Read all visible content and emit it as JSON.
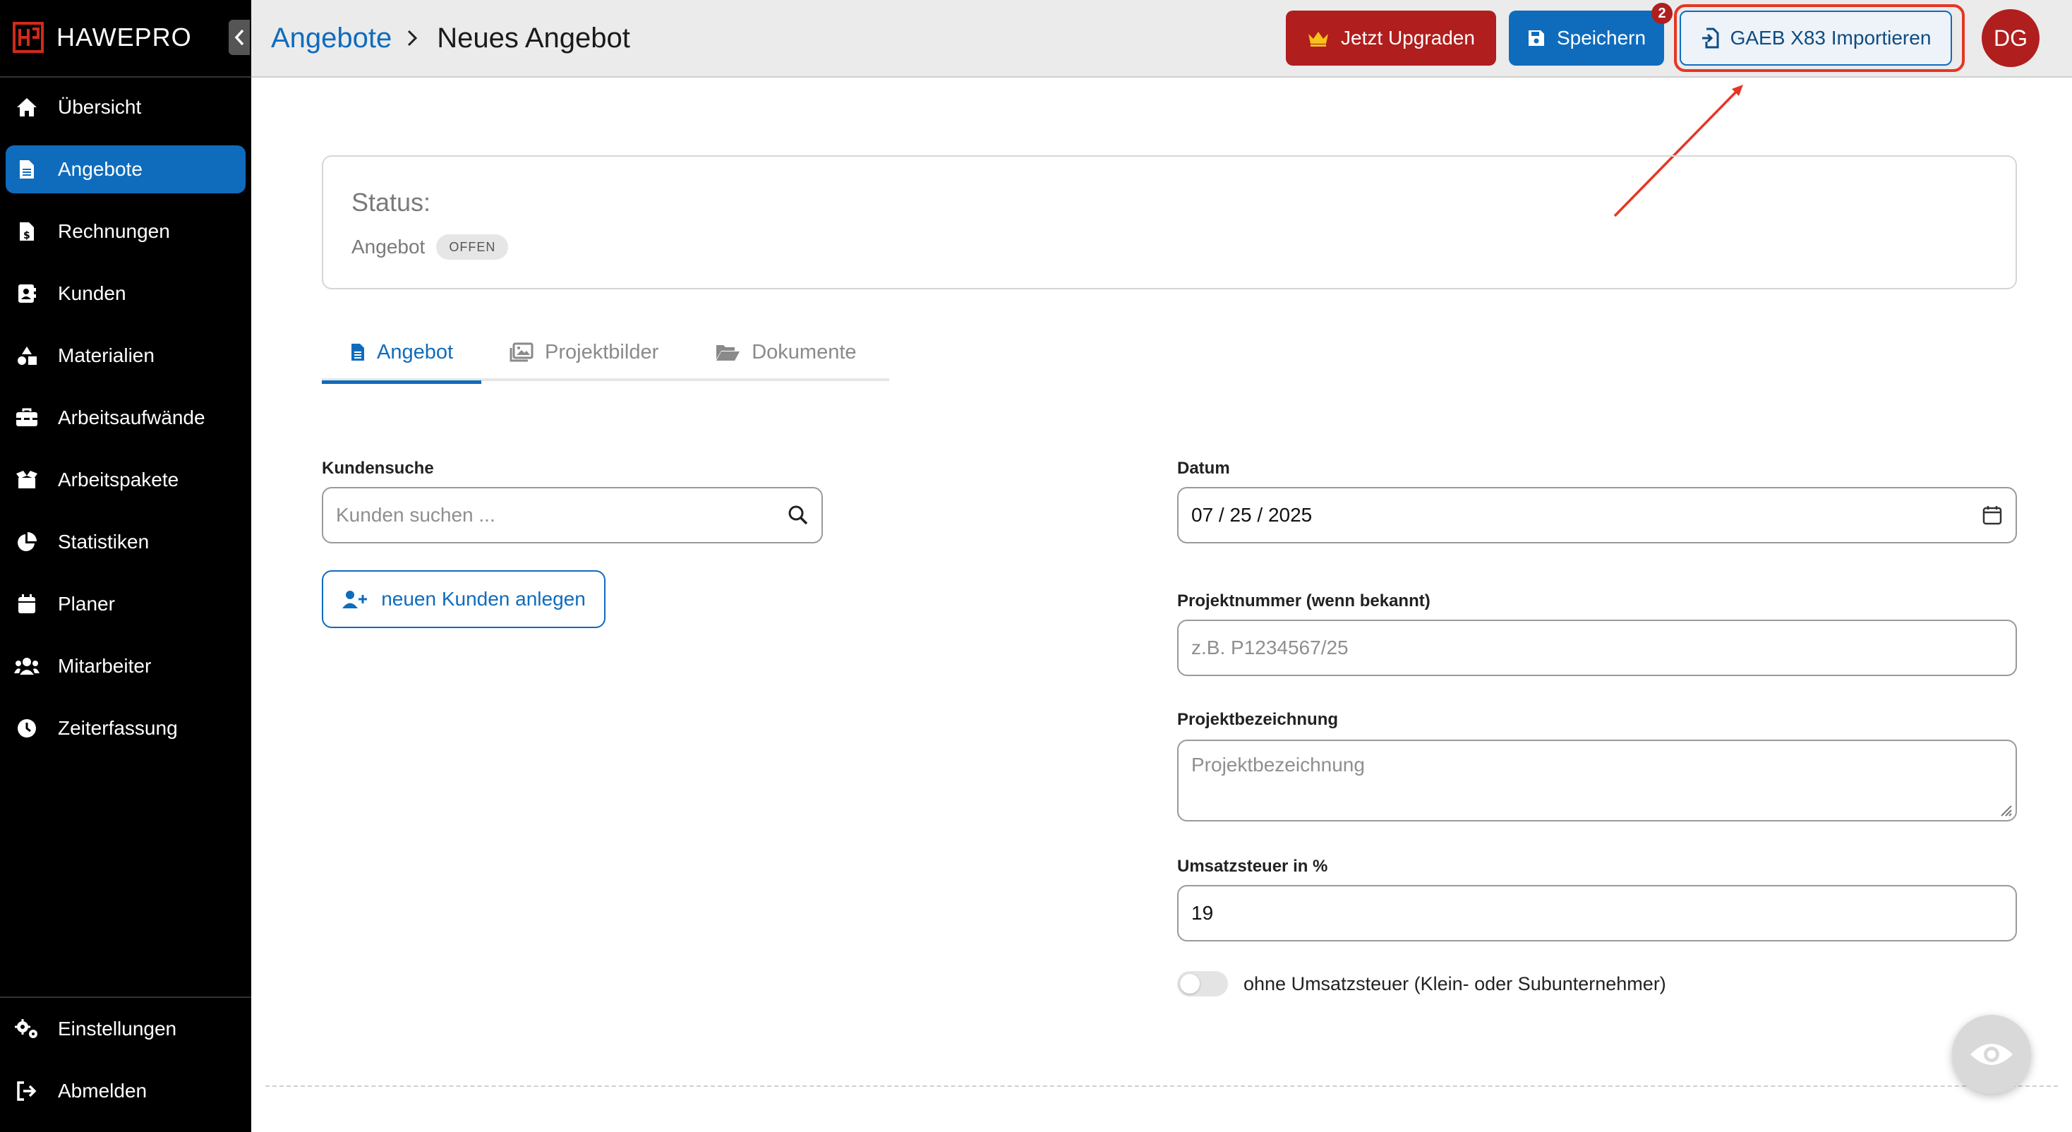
{
  "app": {
    "brand": "HAWEPRO"
  },
  "sidebar": {
    "items": [
      {
        "label": "Übersicht",
        "icon": "home-icon",
        "active": false
      },
      {
        "label": "Angebote",
        "icon": "document-icon",
        "active": true
      },
      {
        "label": "Rechnungen",
        "icon": "invoice-icon",
        "active": false
      },
      {
        "label": "Kunden",
        "icon": "contact-card-icon",
        "active": false
      },
      {
        "label": "Materialien",
        "icon": "shapes-icon",
        "active": false
      },
      {
        "label": "Arbeitsaufwände",
        "icon": "toolbox-icon",
        "active": false
      },
      {
        "label": "Arbeitspakete",
        "icon": "box-open-icon",
        "active": false
      },
      {
        "label": "Statistiken",
        "icon": "pie-chart-icon",
        "active": false
      },
      {
        "label": "Planer",
        "icon": "calendar-icon",
        "active": false
      },
      {
        "label": "Mitarbeiter",
        "icon": "users-icon",
        "active": false
      },
      {
        "label": "Zeiterfassung",
        "icon": "clock-icon",
        "active": false
      }
    ],
    "bottom_items": [
      {
        "label": "Einstellungen",
        "icon": "gears-icon"
      },
      {
        "label": "Abmelden",
        "icon": "logout-icon"
      }
    ]
  },
  "header": {
    "breadcrumb": {
      "parent": "Angebote",
      "current": "Neues Angebot"
    },
    "upgrade_label": "Jetzt Upgraden",
    "save_label": "Speichern",
    "import_label": "GAEB X83 Importieren",
    "badge_count": "2",
    "avatar_initials": "DG"
  },
  "status": {
    "title": "Status:",
    "label": "Angebot",
    "pill": "OFFEN"
  },
  "tabs": [
    {
      "label": "Angebot",
      "icon": "document-icon",
      "active": true
    },
    {
      "label": "Projektbilder",
      "icon": "images-icon",
      "active": false
    },
    {
      "label": "Dokumente",
      "icon": "folder-open-icon",
      "active": false
    }
  ],
  "form": {
    "customer_search": {
      "label": "Kundensuche",
      "placeholder": "Kunden suchen ..."
    },
    "new_customer_label": "neuen Kunden anlegen",
    "date": {
      "label": "Datum",
      "value": "07 / 25 / 2025"
    },
    "project_number": {
      "label": "Projektnummer (wenn bekannt)",
      "placeholder": "z.B. P1234567/25"
    },
    "project_name": {
      "label": "Projektbezeichnung",
      "placeholder": "Projektbezeichnung"
    },
    "vat": {
      "label": "Umsatzsteuer in %",
      "value": "19"
    },
    "no_vat_toggle": {
      "label": "ohne Umsatzsteuer (Klein- oder Subunternehmer)",
      "on": false
    }
  },
  "colors": {
    "accent": "#0f6cbd",
    "danger": "#b01e1e",
    "highlight": "#e53624",
    "sidebar_bg": "#000000"
  }
}
